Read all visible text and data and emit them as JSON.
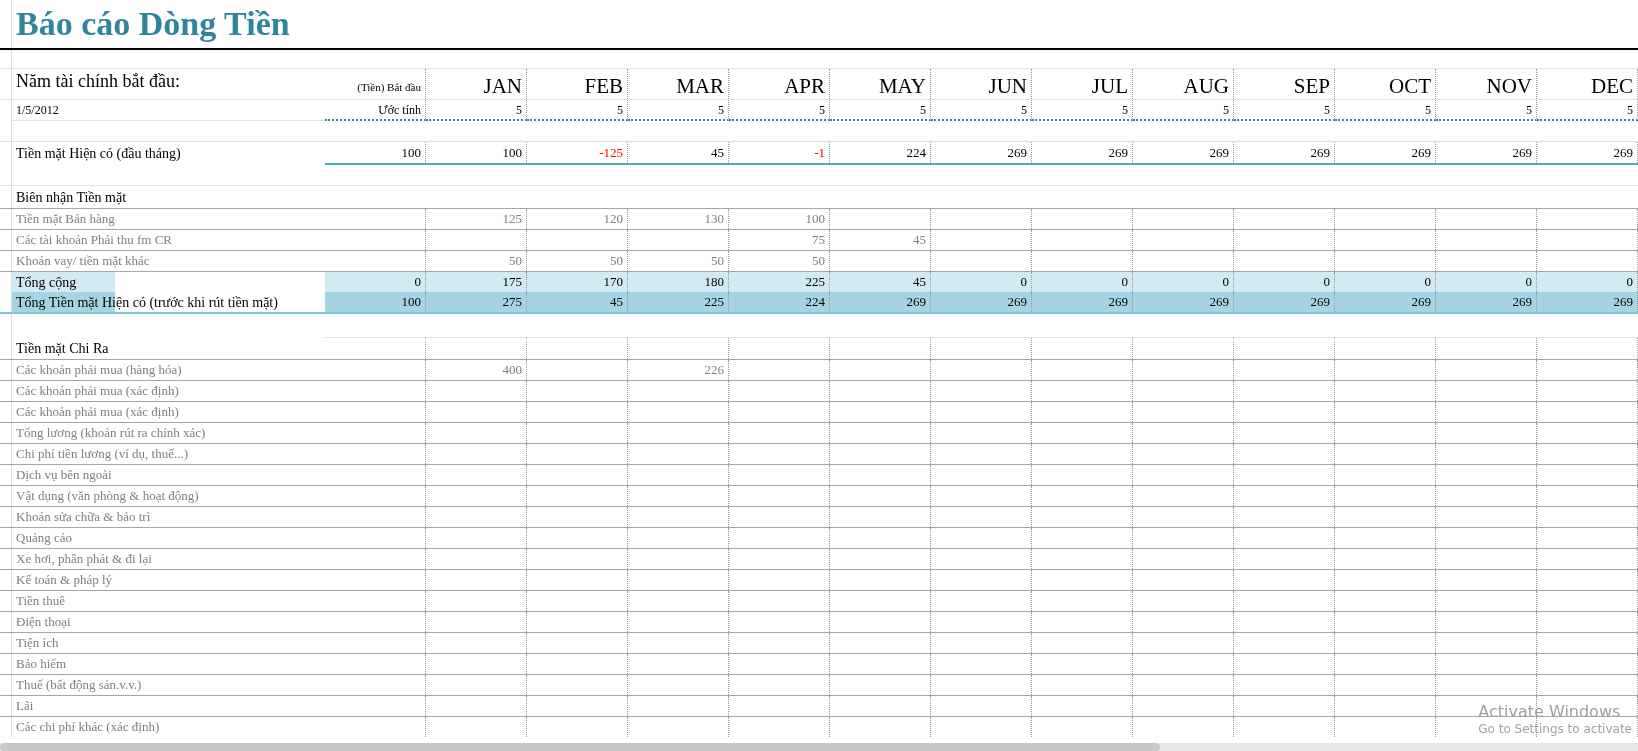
{
  "title": "Báo cáo Dòng Tiền",
  "fiscal_year": {
    "label": "Năm tài chính bắt đầu:",
    "date": "1/5/2012"
  },
  "start_column": {
    "heading": "(Tiền) Bắt đầu",
    "subheading": "Ước tính"
  },
  "months": [
    {
      "name": "JAN",
      "estimate": "5"
    },
    {
      "name": "FEB",
      "estimate": "5"
    },
    {
      "name": "MAR",
      "estimate": "5"
    },
    {
      "name": "APR",
      "estimate": "5"
    },
    {
      "name": "MAY",
      "estimate": "5"
    },
    {
      "name": "JUN",
      "estimate": "5"
    },
    {
      "name": "JUL",
      "estimate": "5"
    },
    {
      "name": "AUG",
      "estimate": "5"
    },
    {
      "name": "SEP",
      "estimate": "5"
    },
    {
      "name": "OCT",
      "estimate": "5"
    },
    {
      "name": "NOV",
      "estimate": "5"
    },
    {
      "name": "DEC",
      "estimate": "5"
    }
  ],
  "cash_on_hand": {
    "label": "Tiền mặt Hiện có (đầu tháng)",
    "cells": [
      {
        "text": "100",
        "negative": false
      },
      {
        "text": "100",
        "negative": false
      },
      {
        "text": "-125",
        "negative": true
      },
      {
        "text": "45",
        "negative": false
      },
      {
        "text": "-1",
        "negative": true
      },
      {
        "text": "224",
        "negative": false
      },
      {
        "text": "269",
        "negative": false
      },
      {
        "text": "269",
        "negative": false
      },
      {
        "text": "269",
        "negative": false
      },
      {
        "text": "269",
        "negative": false
      },
      {
        "text": "269",
        "negative": false
      },
      {
        "text": "269",
        "negative": false
      },
      {
        "text": "269",
        "negative": false
      }
    ]
  },
  "receipts": {
    "heading": "Biên nhận Tiền mặt",
    "rows": [
      {
        "label": "Tiền mặt Bán hàng",
        "cells": [
          null,
          "125",
          "120",
          "130",
          "100",
          null,
          null,
          null,
          null,
          null,
          null,
          null,
          null
        ]
      },
      {
        "label": "Các tài khoản Phải thu fm CR",
        "cells": [
          null,
          null,
          null,
          null,
          "75",
          "45",
          null,
          null,
          null,
          null,
          null,
          null,
          null
        ]
      },
      {
        "label": "Khoản vay/ tiền mặt khác",
        "cells": [
          null,
          "50",
          "50",
          "50",
          "50",
          null,
          null,
          null,
          null,
          null,
          null,
          null,
          null
        ]
      }
    ],
    "total": {
      "label": "Tổng cộng",
      "cells": [
        "0",
        "175",
        "170",
        "180",
        "225",
        "45",
        "0",
        "0",
        "0",
        "0",
        "0",
        "0",
        "0"
      ]
    }
  },
  "total_cash": {
    "label": "Tổng Tiền mặt Hiện có (trước khi rút tiền mặt)",
    "cells": [
      "100",
      "275",
      "45",
      "225",
      "224",
      "269",
      "269",
      "269",
      "269",
      "269",
      "269",
      "269",
      "269"
    ]
  },
  "payments": {
    "heading": "Tiền mặt Chi Ra",
    "rows": [
      {
        "label": "Các khoản phải mua (hàng hóa)",
        "cells": [
          null,
          "400",
          null,
          "226",
          null,
          null,
          null,
          null,
          null,
          null,
          null,
          null,
          null
        ]
      },
      {
        "label": "Các khoản phải mua (xác định)",
        "cells": []
      },
      {
        "label": "Các khoản phải mua (xác định)",
        "cells": []
      },
      {
        "label": "Tổng lương (khoản rút ra chính xác)",
        "cells": []
      },
      {
        "label": "Chi phí tiền lương (ví dụ, thuế...)",
        "cells": []
      },
      {
        "label": "Dịch vụ bên ngoài",
        "cells": []
      },
      {
        "label": "Vật dụng (văn phòng & hoạt động)",
        "cells": []
      },
      {
        "label": "Khoản sửa chữa & bảo trì",
        "cells": []
      },
      {
        "label": "Quảng cáo",
        "cells": []
      },
      {
        "label": "Xe hơi, phân phát & đi lại",
        "cells": []
      },
      {
        "label": "Kế toán & pháp lý",
        "cells": []
      },
      {
        "label": "Tiền thuê",
        "cells": []
      },
      {
        "label": "Điện thoại",
        "cells": []
      },
      {
        "label": "Tiện ích",
        "cells": []
      },
      {
        "label": "Bảo hiểm",
        "cells": []
      },
      {
        "label": "Thuế (bất động sản.v.v.)",
        "cells": []
      },
      {
        "label": "Lãi",
        "cells": []
      },
      {
        "label": "Các chi phí khác (xác định)",
        "cells": []
      }
    ]
  },
  "activation_notice": {
    "title": "Activate Windows",
    "subtitle": "Go to Settings to activate"
  }
}
